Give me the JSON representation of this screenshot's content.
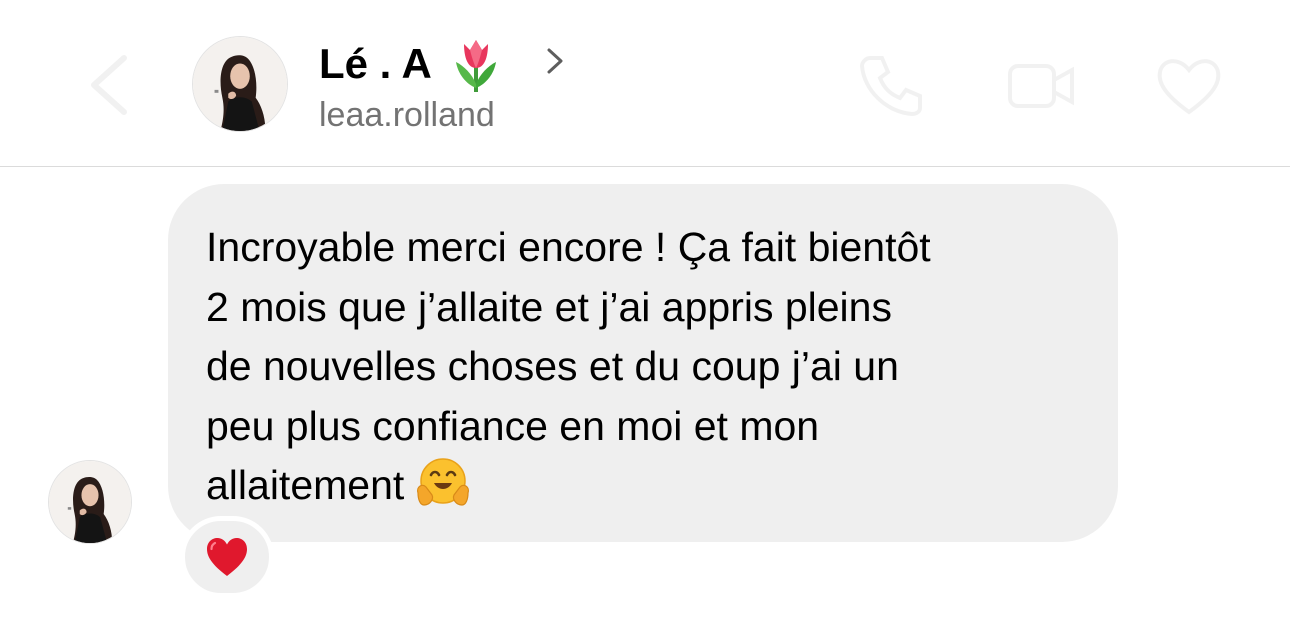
{
  "header": {
    "contact_name": "Lé . A",
    "name_emoji": "tulip-icon",
    "username": "leaa.rolland",
    "faded_actions": [
      "back-chevron-icon",
      "phone-icon",
      "video-camera-icon",
      "heart-outline-icon"
    ]
  },
  "message": {
    "text": "Incroyable merci encore ! Ça fait bientôt\n2 mois que j’allaite et j’ai appris pleins\nde nouvelles choses et du coup j’ai un\npeu plus confiance en moi et mon\nallaitement",
    "emoji": "hugging-face-icon",
    "reaction": "red-heart-icon"
  },
  "colors": {
    "bubble": "#efefef",
    "username": "#737373",
    "divider": "#dbdbdb",
    "heart": "#e0182d"
  }
}
